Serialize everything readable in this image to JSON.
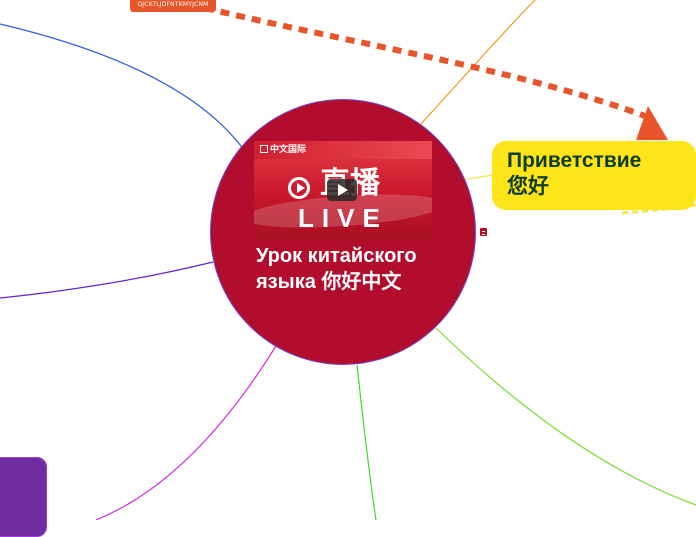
{
  "tag_badge": {
    "text": "GJCKTLJDFNTKMYJCNM",
    "color": "#e8552a"
  },
  "central_topic": {
    "title": "Урок китайского языка 你好中文",
    "fill": "#b30d2e",
    "thumbnail": {
      "logo_text": "中文国际",
      "headline": "直播",
      "live_text": "LIVE"
    }
  },
  "topic_greeting": {
    "line1": "Приветствие",
    "line2": "您好",
    "fill": "#fde51a",
    "text_color": "#0e3d24"
  },
  "connector": {
    "color": "#e8552a",
    "style": "dashed-arrow"
  },
  "branch_colors": {
    "blue": "#2d5be3",
    "orange": "#f29a1d",
    "yellow": "#f3e84a",
    "indigo": "#6a21d6",
    "magenta": "#d12cdc",
    "green": "#41d62a",
    "lime": "#7edb31"
  },
  "side_node": {
    "fill": "#6f2da0"
  }
}
